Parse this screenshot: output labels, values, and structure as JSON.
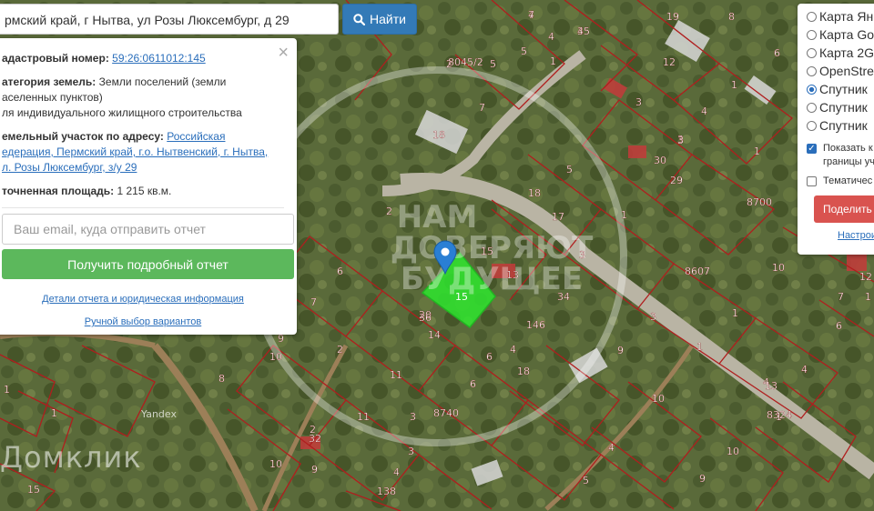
{
  "search": {
    "value": "рмский край, г Нытва, ул Розы Люксембург, д 29",
    "button_label": "Найти"
  },
  "info": {
    "cadastral_label": "адастровый номер:",
    "cadastral_value": "59:26:0611012:145",
    "category_label": "атегория земель:",
    "category_value": "Земли поселений (земли",
    "category_line2": "аселенных пунктов)",
    "category_line3": "ля индивидуального жилищного строительства",
    "address_label": "емельный участок по адресу:",
    "address_value_1": "Российская",
    "address_value_2": "едерация, Пермский край, г.о. Нытвенский, г. Нытва,",
    "address_value_3": "л. Розы Люксембург, з/у 29",
    "area_label": "точненная площадь:",
    "area_value": "1 215 кв.м.",
    "email_placeholder": "Ваш email, куда отправить отчет",
    "report_button": "Получить подробный отчет",
    "details_link": "Детали отчета и юридическая информация",
    "manual_link": "Ручной выбор вариантов",
    "close": "×"
  },
  "layers": {
    "options": [
      {
        "label": "Карта Ян",
        "selected": false
      },
      {
        "label": "Карта Go",
        "selected": false
      },
      {
        "label": "Карта 2G",
        "selected": false
      },
      {
        "label": "OpenStre",
        "selected": false
      },
      {
        "label": "Спутник ",
        "selected": true
      },
      {
        "label": "Спутник ",
        "selected": false
      },
      {
        "label": "Спутник ",
        "selected": false
      }
    ],
    "show_borders_line1": "Показать к",
    "show_borders_line2": "границы уч",
    "thematic": "Тематичес",
    "share_button": "Поделить",
    "settings_link": "Настрои"
  },
  "map": {
    "parcel_labels": [
      "4",
      "35",
      "19",
      "5",
      "8",
      "1",
      "4",
      "2",
      "5",
      "12",
      "1",
      "8045/2",
      "7",
      "6",
      "3",
      "4",
      "3",
      "18",
      "5",
      "30",
      "29",
      "8700",
      "18",
      "17",
      "1",
      "2",
      "15",
      "13",
      "3",
      "8607",
      "10",
      "1",
      "6",
      "20",
      "34",
      "146",
      "3",
      "1",
      "7",
      "36",
      "14",
      "9",
      "4",
      "2",
      "6",
      "10",
      "8",
      "11",
      "8324",
      "10",
      "4",
      "9",
      "6",
      "3",
      "8740",
      "18",
      "11",
      "1",
      "32",
      "2",
      "9",
      "10",
      "4",
      "3",
      "138",
      "5",
      "4",
      "10",
      "15",
      "1",
      "9",
      "7",
      "6",
      "1",
      "4",
      "3",
      "4",
      "1",
      "13",
      "12",
      "1",
      "7",
      "4"
    ],
    "parcel_label_center": "15",
    "watermark_center": "НАМ ДОВЕРЯЮТ БУДУЩЕЕ",
    "watermark_brand": "Домклик",
    "yandex": "Yandex",
    "colors": {
      "parcel_border": "#b01e1e",
      "selected_parcel": "#2ee62e",
      "pin": "#2a7fd4"
    }
  }
}
